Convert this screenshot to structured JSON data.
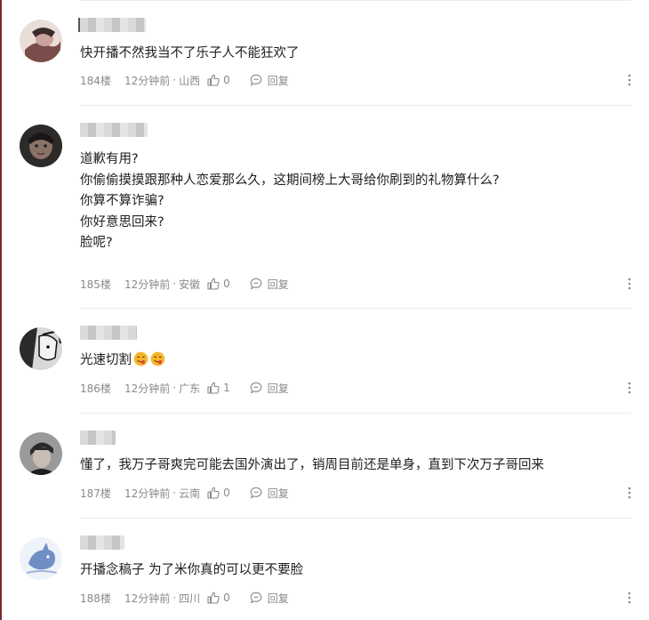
{
  "comments": [
    {
      "text_lines": [
        "快开播不然我当不了乐子人不能狂欢了"
      ],
      "floor": "184楼",
      "time": "12分钟前",
      "separator": "·",
      "region": "山西",
      "likes": "0",
      "reply_label": "回复"
    },
    {
      "text_lines": [
        "道歉有用?",
        "你偷偷摸摸跟那种人恋爱那么久，这期间榜上大哥给你刷到的礼物算什么?",
        "你算不算诈骗?",
        "你好意思回来?",
        "脸呢?"
      ],
      "floor": "185楼",
      "time": "12分钟前",
      "separator": "·",
      "region": "安徽",
      "likes": "0",
      "reply_label": "回复"
    },
    {
      "text_lines": [
        "光速切割"
      ],
      "floor": "186楼",
      "time": "12分钟前",
      "separator": "·",
      "region": "广东",
      "likes": "1",
      "reply_label": "回复"
    },
    {
      "text_lines": [
        "懂了，我万子哥爽完可能去国外演出了，销周目前还是单身，直到下次万子哥回来"
      ],
      "floor": "187楼",
      "time": "12分钟前",
      "separator": "·",
      "region": "云南",
      "likes": "0",
      "reply_label": "回复"
    },
    {
      "text_lines": [
        "开播念稿子 为了米你真的可以更不要脸"
      ],
      "floor": "188楼",
      "time": "12分钟前",
      "separator": "·",
      "region": "四川",
      "likes": "0",
      "reply_label": "回复"
    }
  ],
  "icons": {
    "like": "thumbs-up-icon",
    "reply": "chat-bubble-icon",
    "more": "more-vertical-icon",
    "emoji": "yummy-face-emoji"
  },
  "colors": {
    "meta_text": "#8a8a8a",
    "body_text": "#1e1e1e",
    "divider": "#ececec"
  }
}
